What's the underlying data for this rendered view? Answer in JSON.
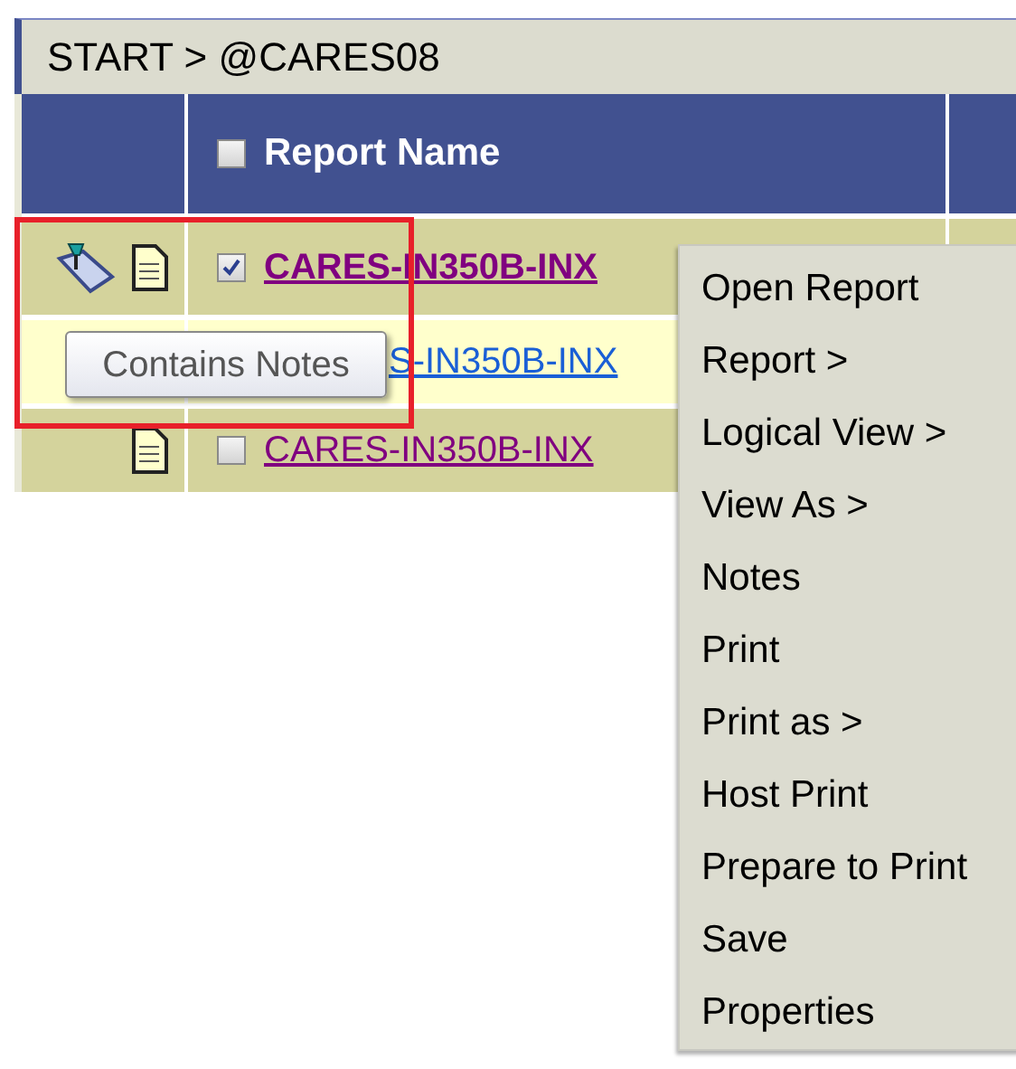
{
  "breadcrumb": "START > @CARES08",
  "table": {
    "header": {
      "label": "Report Name",
      "checked": false
    },
    "rows": [
      {
        "has_notes": true,
        "checked": true,
        "name": "CARES-IN350B-INX",
        "visited": true
      },
      {
        "name": "S-IN350B-INX",
        "visited": false
      },
      {
        "has_notes": false,
        "checked": false,
        "name": "CARES-IN350B-INX",
        "visited": true
      }
    ]
  },
  "tooltip": {
    "text": "Contains Notes"
  },
  "context_menu": [
    "Open Report",
    "Report >",
    "Logical View >",
    "View As >",
    "Notes",
    "Print",
    "Print as >",
    "Host Print",
    "Prepare to Print",
    "Save",
    "Properties"
  ]
}
